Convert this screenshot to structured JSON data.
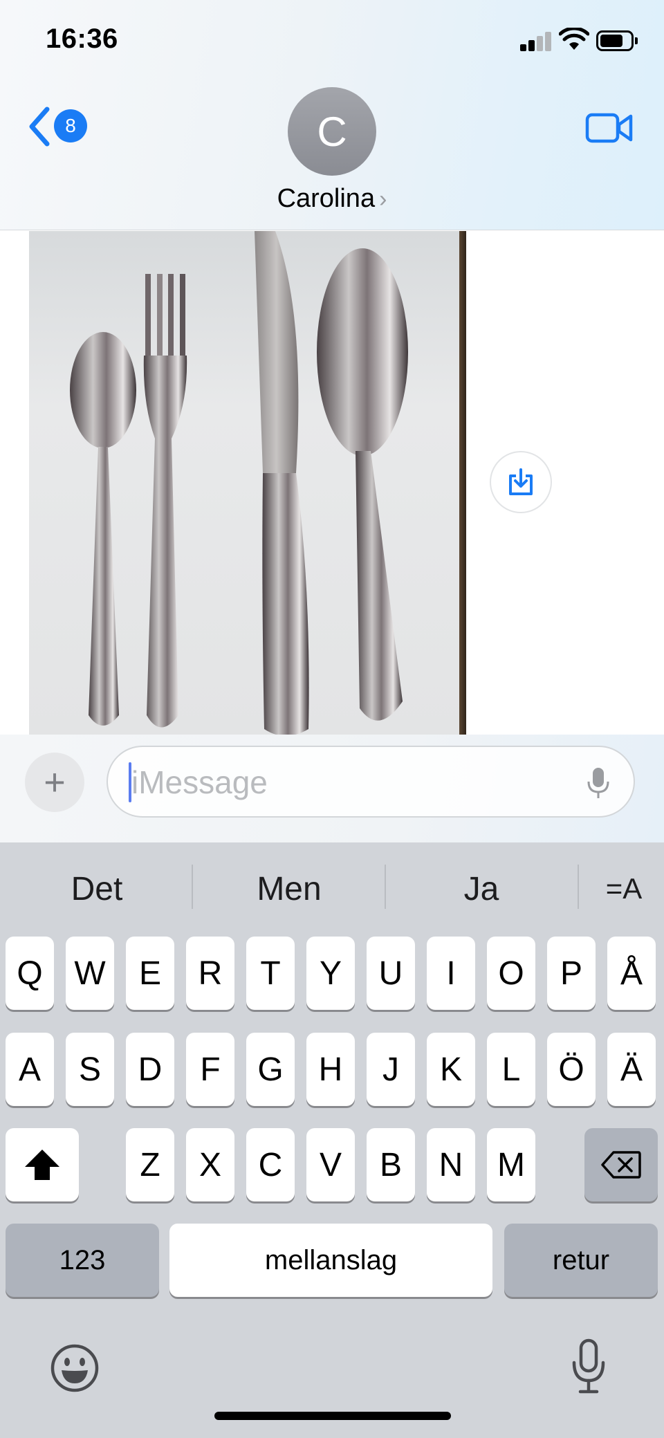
{
  "status_bar": {
    "time": "16:36"
  },
  "header": {
    "back_badge": "8",
    "avatar_initial": "C",
    "contact_name": "Carolina",
    "contact_chevron": "›"
  },
  "message": {
    "photo_alt": "Photo of cutlery: teaspoon, fork, knife, spoon",
    "save_icon": "save-to-photos-icon"
  },
  "compose": {
    "plus_label": "+",
    "placeholder": "iMessage"
  },
  "keyboard": {
    "suggestions": [
      "Det",
      "Men",
      "Ja"
    ],
    "format_label": "=A",
    "row1": [
      "Q",
      "W",
      "E",
      "R",
      "T",
      "Y",
      "U",
      "I",
      "O",
      "P",
      "Å"
    ],
    "row2": [
      "A",
      "S",
      "D",
      "F",
      "G",
      "H",
      "J",
      "K",
      "L",
      "Ö",
      "Ä"
    ],
    "row3": [
      "Z",
      "X",
      "C",
      "V",
      "B",
      "N",
      "M"
    ],
    "numbers_label": "123",
    "space_label": "mellanslag",
    "return_label": "retur"
  },
  "colors": {
    "accent": "#1a7cf5",
    "keyboard_bg": "#d1d4d9",
    "key_dark": "#aeb3bc"
  }
}
